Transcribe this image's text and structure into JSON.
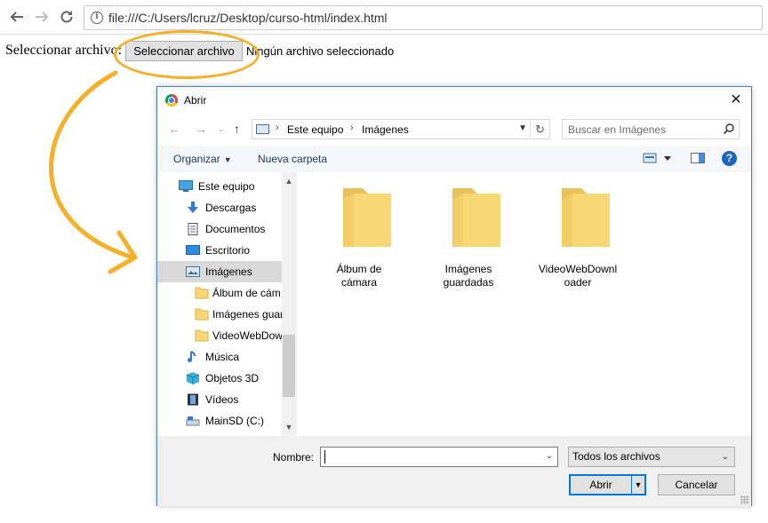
{
  "browser": {
    "url": "file:///C:/Users/lcruz/Desktop/curso-html/index.html"
  },
  "page": {
    "file_label": "Seleccionar archivo:",
    "file_button": "Seleccionar archivo",
    "file_status": "Ningún archivo seleccionado"
  },
  "annotation": {
    "highlight_color": "#f5b027"
  },
  "dialog": {
    "title": "Abrir",
    "breadcrumb": [
      "Este equipo",
      "Imágenes"
    ],
    "search_placeholder": "Buscar en Imágenes",
    "toolbar": {
      "organize": "Organizar",
      "new_folder": "Nueva carpeta"
    },
    "nav_items": [
      {
        "label": "Este equipo",
        "icon": "computer-icon"
      },
      {
        "label": "Descargas",
        "icon": "download-icon"
      },
      {
        "label": "Documentos",
        "icon": "document-icon"
      },
      {
        "label": "Escritorio",
        "icon": "desktop-icon"
      },
      {
        "label": "Imágenes",
        "icon": "pictures-icon"
      },
      {
        "label": "Álbum de cám",
        "icon": "folder-icon"
      },
      {
        "label": "Imágenes guar",
        "icon": "folder-icon"
      },
      {
        "label": "VideoWebDow",
        "icon": "folder-icon"
      },
      {
        "label": "Música",
        "icon": "music-icon"
      },
      {
        "label": "Objetos 3D",
        "icon": "cube-icon"
      },
      {
        "label": "Vídeos",
        "icon": "video-icon"
      },
      {
        "label": "MainSD (C:)",
        "icon": "drive-icon"
      }
    ],
    "folders": [
      {
        "line1": "Álbum de",
        "line2": "cámara"
      },
      {
        "line1": "Imágenes",
        "line2": "guardadas"
      },
      {
        "line1": "VideoWebDownl",
        "line2": "oader"
      }
    ],
    "name_label": "Nombre:",
    "name_value": "",
    "file_type": "Todos los archivos",
    "open_button": "Abrir",
    "cancel_button": "Cancelar",
    "accent_color": "#0078d7"
  }
}
